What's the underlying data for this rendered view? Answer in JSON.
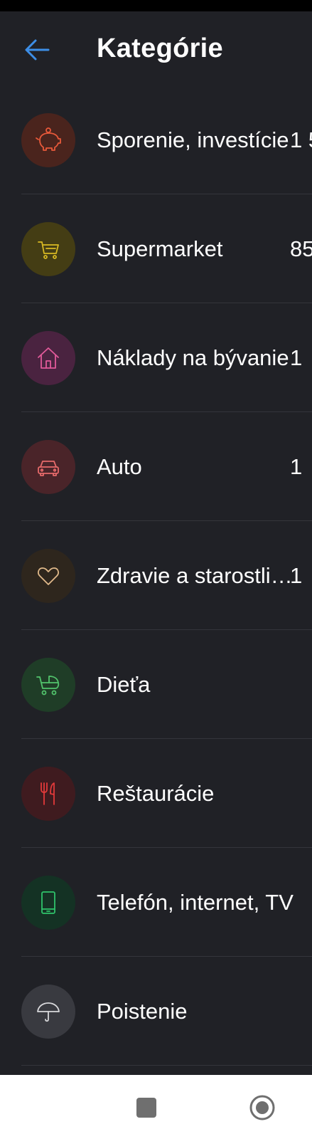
{
  "header": {
    "title": "Kategórie",
    "back_icon": "arrow-left-icon"
  },
  "colors": {
    "background": "#202126",
    "accent": "#3d8ee6",
    "divider": "#34353b"
  },
  "categories": [
    {
      "label": "Sporenie, investície",
      "amount": "1 5",
      "icon": "piggy-bank-icon",
      "icon_color": "#e8593a",
      "bg_color": "#4a241d"
    },
    {
      "label": "Supermarket",
      "amount": "85",
      "icon": "shopping-cart-icon",
      "icon_color": "#d8b923",
      "bg_color": "#443d14"
    },
    {
      "label": "Náklady na bývanie",
      "amount": "1",
      "icon": "home-icon",
      "icon_color": "#e25a9a",
      "bg_color": "#4a2340"
    },
    {
      "label": "Auto",
      "amount": "1",
      "icon": "car-icon",
      "icon_color": "#e66a6a",
      "bg_color": "#4a2429"
    },
    {
      "label": "Zdravie a starostlivosť",
      "amount": "1",
      "icon": "heart-icon",
      "icon_color": "#e0b98a",
      "bg_color": "#2e261d"
    },
    {
      "label": "Dieťa",
      "amount": "",
      "icon": "baby-stroller-icon",
      "icon_color": "#52c36c",
      "bg_color": "#1f3d27"
    },
    {
      "label": "Reštaurácie",
      "amount": "",
      "icon": "cutlery-icon",
      "icon_color": "#e23a3a",
      "bg_color": "#3f1b1f"
    },
    {
      "label": "Telefón, internet, TV",
      "amount": "",
      "icon": "mobile-phone-icon",
      "icon_color": "#2fc36b",
      "bg_color": "#143224"
    },
    {
      "label": "Poistenie",
      "amount": "",
      "icon": "umbrella-icon",
      "icon_color": "#d9d9dc",
      "bg_color": "#393a40"
    }
  ],
  "navigation": {
    "recents_icon": "square-icon",
    "home_icon": "circle-home-icon"
  }
}
